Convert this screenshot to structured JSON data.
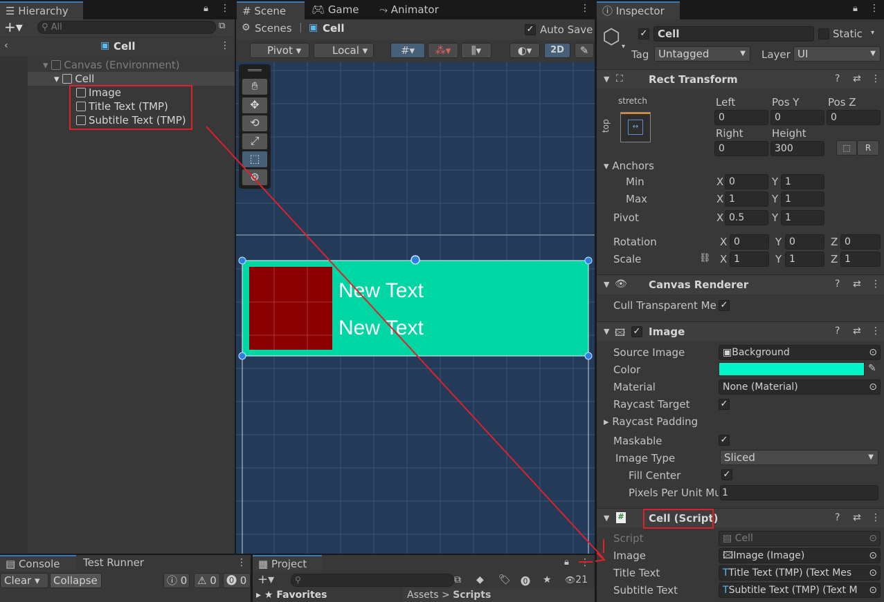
{
  "hierarchy": {
    "tab": "Hierarchy",
    "search_placeholder": "All",
    "breadcrumb": "Cell",
    "tree": [
      {
        "label": "Canvas (Environment)"
      },
      {
        "label": "Cell"
      },
      {
        "label": "Image"
      },
      {
        "label": "Title Text (TMP)"
      },
      {
        "label": "Subtitle Text (TMP)"
      }
    ]
  },
  "scene": {
    "tabs": [
      "Scene",
      "Game",
      "Animator"
    ],
    "breadcrumb_root": "Scenes",
    "breadcrumb_current": "Cell",
    "auto_save_label": "Auto Save",
    "toolbar": {
      "pivot": "Pivot",
      "local": "Local",
      "mode_2d": "2D"
    },
    "canvas_texts": [
      "New Text",
      "New Text"
    ],
    "colors": {
      "background": "#233b58",
      "cell": "#00d6a3",
      "image": "#8b0000"
    }
  },
  "bottom": {
    "console_tab": "Console",
    "test_runner_tab": "Test Runner",
    "clear": "Clear",
    "collapse": "Collapse",
    "counts": [
      "0",
      "0",
      "0"
    ],
    "project_tab": "Project",
    "favorites": "Favorites",
    "assets": "Assets",
    "scripts": "Scripts",
    "project_count": "21"
  },
  "inspector": {
    "tab": "Inspector",
    "object_name": "Cell",
    "static_label": "Static",
    "tag_label": "Tag",
    "tag_value": "Untagged",
    "layer_label": "Layer",
    "layer_value": "UI",
    "rect_transform": {
      "title": "Rect Transform",
      "anchor_preset": "stretch",
      "anchor_side": "top",
      "left_label": "Left",
      "left": "0",
      "posy_label": "Pos Y",
      "posy": "0",
      "posz_label": "Pos Z",
      "posz": "0",
      "right_label": "Right",
      "right": "0",
      "height_label": "Height",
      "height": "300",
      "anchors_label": "Anchors",
      "min_label": "Min",
      "min_x": "0",
      "min_y": "1",
      "max_label": "Max",
      "max_x": "1",
      "max_y": "1",
      "pivot_label": "Pivot",
      "pivot_x": "0.5",
      "pivot_y": "1",
      "rotation_label": "Rotation",
      "rot_x": "0",
      "rot_y": "0",
      "rot_z": "0",
      "scale_label": "Scale",
      "scale_x": "1",
      "scale_y": "1",
      "scale_z": "1",
      "x": "X",
      "y": "Y",
      "z": "Z"
    },
    "canvas_renderer": {
      "title": "Canvas Renderer",
      "cull_label": "Cull Transparent Mes"
    },
    "image": {
      "title": "Image",
      "source_label": "Source Image",
      "source_value": "Background",
      "color_label": "Color",
      "color_value": "#00f5c8",
      "material_label": "Material",
      "material_value": "None (Material)",
      "raycast_label": "Raycast Target",
      "padding_label": "Raycast Padding",
      "maskable_label": "Maskable",
      "type_label": "Image Type",
      "type_value": "Sliced",
      "fill_label": "Fill Center",
      "ppu_label": "Pixels Per Unit Mu",
      "ppu_value": "1"
    },
    "cell_script": {
      "title": "Cell (Script)",
      "script_label": "Script",
      "script_value": "Cell",
      "image_label": "Image",
      "image_value": "Image (Image)",
      "title_label": "Title Text",
      "title_value": "Title Text (TMP) (Text Mes",
      "subtitle_label": "Subtitle Text",
      "subtitle_value": "Subtitle Text (TMP) (Text M"
    }
  },
  "annotation_color": "#e0202a"
}
